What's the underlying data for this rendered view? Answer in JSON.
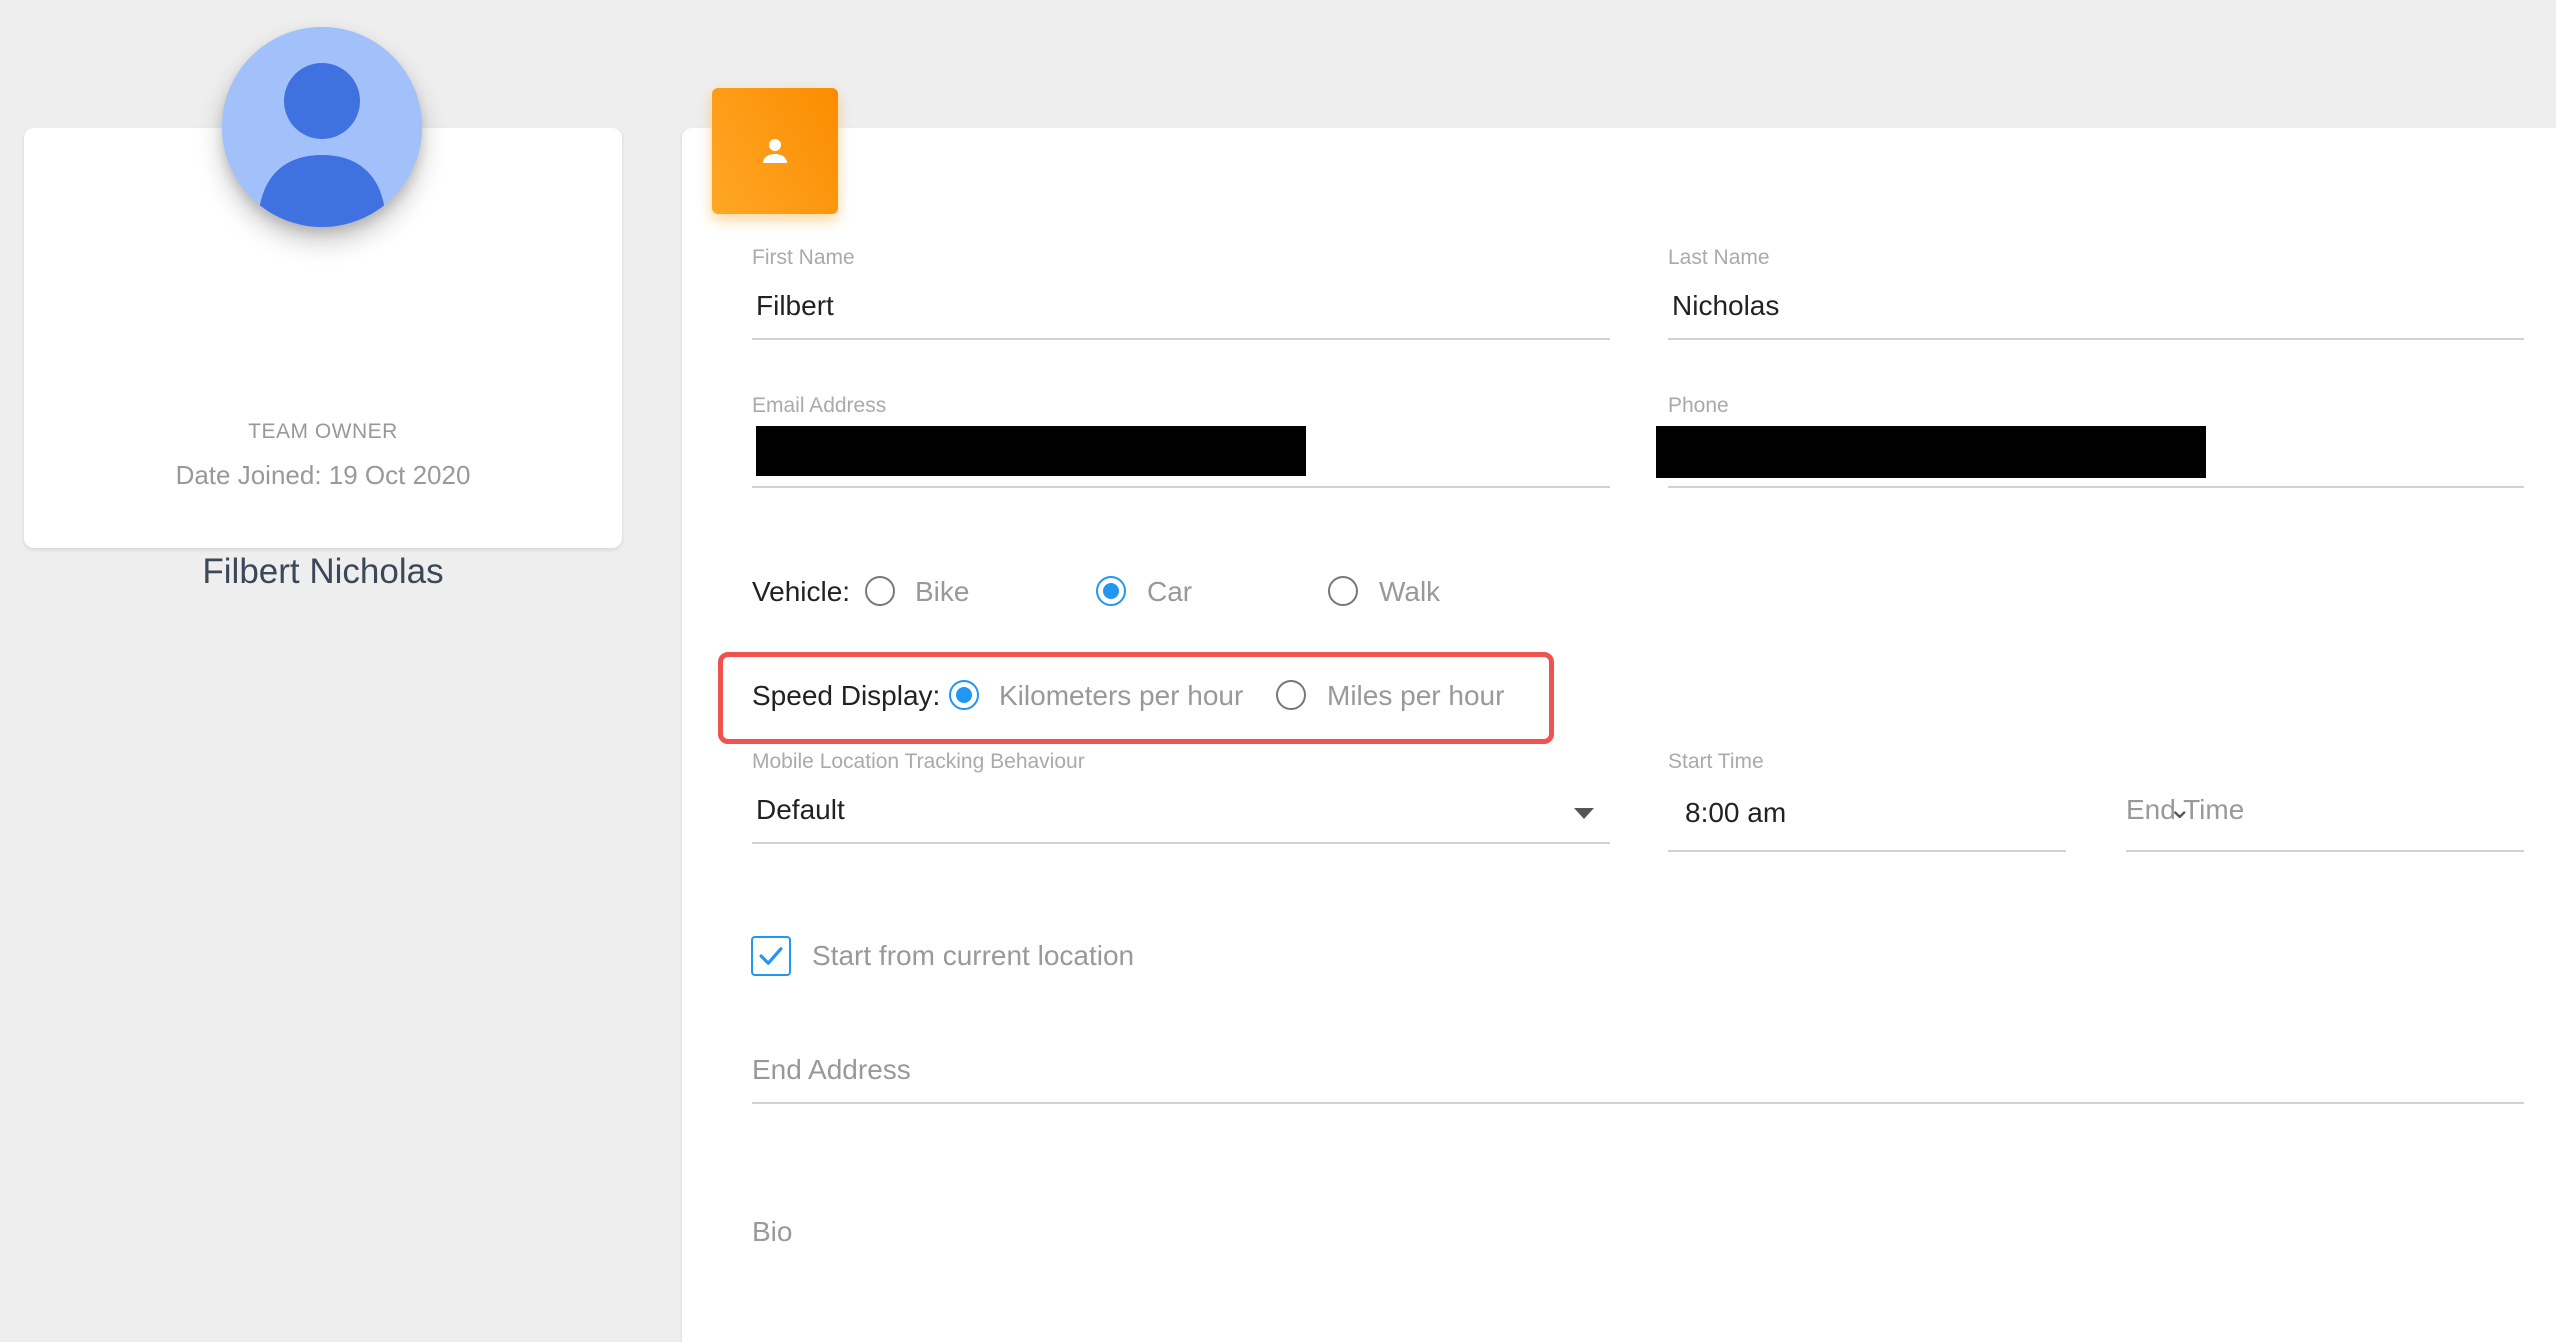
{
  "profile": {
    "role": "TEAM OWNER",
    "date_joined": "Date Joined: 19 Oct 2020",
    "name": "Filbert Nicholas",
    "avatar_icon": "user-avatar-icon",
    "avatar_bg": "#a2c1fa",
    "avatar_fg": "#3f72e0"
  },
  "header": {
    "icon": "person-icon",
    "color": "#fb8c00"
  },
  "form": {
    "first_name": {
      "label": "First Name",
      "value": "Filbert"
    },
    "last_name": {
      "label": "Last Name",
      "value": "Nicholas"
    },
    "email": {
      "label": "Email Address",
      "value": ""
    },
    "phone": {
      "label": "Phone",
      "value": ""
    },
    "vehicle": {
      "label": "Vehicle:",
      "options": [
        "Bike",
        "Car",
        "Walk"
      ],
      "selected": "Car"
    },
    "speed_display": {
      "label": "Speed Display:",
      "options": [
        "Kilometers per hour",
        "Miles per hour"
      ],
      "selected": "Kilometers per hour",
      "highlight_color": "#ef5350"
    },
    "tracking": {
      "label": "Mobile Location Tracking Behaviour",
      "value": "Default"
    },
    "start_time": {
      "label": "Start Time",
      "value": "8:00 am"
    },
    "end_time": {
      "placeholder": "End Time"
    },
    "start_from_current": {
      "label": "Start from current location",
      "checked": true
    },
    "end_address": {
      "placeholder": "End Address"
    },
    "bio": {
      "placeholder": "Bio"
    }
  },
  "accent_color": "#2196f3"
}
